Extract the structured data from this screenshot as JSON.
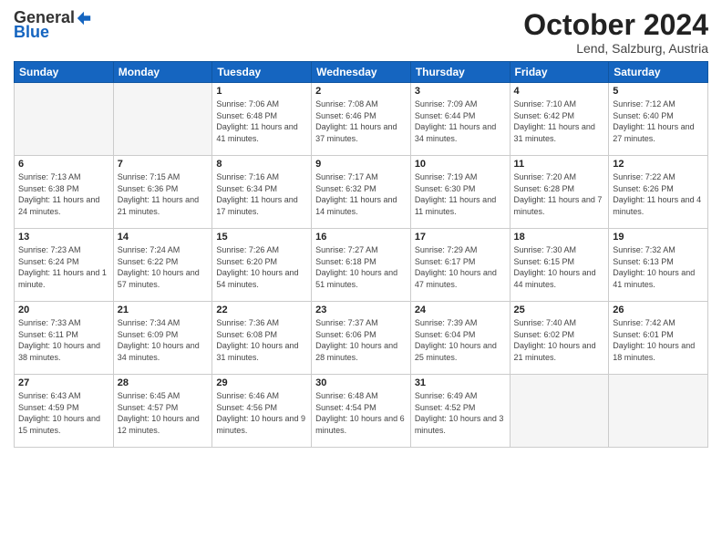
{
  "logo": {
    "general": "General",
    "blue": "Blue"
  },
  "header": {
    "month": "October 2024",
    "location": "Lend, Salzburg, Austria"
  },
  "weekdays": [
    "Sunday",
    "Monday",
    "Tuesday",
    "Wednesday",
    "Thursday",
    "Friday",
    "Saturday"
  ],
  "weeks": [
    [
      {
        "day": "",
        "info": ""
      },
      {
        "day": "",
        "info": ""
      },
      {
        "day": "1",
        "info": "Sunrise: 7:06 AM\nSunset: 6:48 PM\nDaylight: 11 hours and 41 minutes."
      },
      {
        "day": "2",
        "info": "Sunrise: 7:08 AM\nSunset: 6:46 PM\nDaylight: 11 hours and 37 minutes."
      },
      {
        "day": "3",
        "info": "Sunrise: 7:09 AM\nSunset: 6:44 PM\nDaylight: 11 hours and 34 minutes."
      },
      {
        "day": "4",
        "info": "Sunrise: 7:10 AM\nSunset: 6:42 PM\nDaylight: 11 hours and 31 minutes."
      },
      {
        "day": "5",
        "info": "Sunrise: 7:12 AM\nSunset: 6:40 PM\nDaylight: 11 hours and 27 minutes."
      }
    ],
    [
      {
        "day": "6",
        "info": "Sunrise: 7:13 AM\nSunset: 6:38 PM\nDaylight: 11 hours and 24 minutes."
      },
      {
        "day": "7",
        "info": "Sunrise: 7:15 AM\nSunset: 6:36 PM\nDaylight: 11 hours and 21 minutes."
      },
      {
        "day": "8",
        "info": "Sunrise: 7:16 AM\nSunset: 6:34 PM\nDaylight: 11 hours and 17 minutes."
      },
      {
        "day": "9",
        "info": "Sunrise: 7:17 AM\nSunset: 6:32 PM\nDaylight: 11 hours and 14 minutes."
      },
      {
        "day": "10",
        "info": "Sunrise: 7:19 AM\nSunset: 6:30 PM\nDaylight: 11 hours and 11 minutes."
      },
      {
        "day": "11",
        "info": "Sunrise: 7:20 AM\nSunset: 6:28 PM\nDaylight: 11 hours and 7 minutes."
      },
      {
        "day": "12",
        "info": "Sunrise: 7:22 AM\nSunset: 6:26 PM\nDaylight: 11 hours and 4 minutes."
      }
    ],
    [
      {
        "day": "13",
        "info": "Sunrise: 7:23 AM\nSunset: 6:24 PM\nDaylight: 11 hours and 1 minute."
      },
      {
        "day": "14",
        "info": "Sunrise: 7:24 AM\nSunset: 6:22 PM\nDaylight: 10 hours and 57 minutes."
      },
      {
        "day": "15",
        "info": "Sunrise: 7:26 AM\nSunset: 6:20 PM\nDaylight: 10 hours and 54 minutes."
      },
      {
        "day": "16",
        "info": "Sunrise: 7:27 AM\nSunset: 6:18 PM\nDaylight: 10 hours and 51 minutes."
      },
      {
        "day": "17",
        "info": "Sunrise: 7:29 AM\nSunset: 6:17 PM\nDaylight: 10 hours and 47 minutes."
      },
      {
        "day": "18",
        "info": "Sunrise: 7:30 AM\nSunset: 6:15 PM\nDaylight: 10 hours and 44 minutes."
      },
      {
        "day": "19",
        "info": "Sunrise: 7:32 AM\nSunset: 6:13 PM\nDaylight: 10 hours and 41 minutes."
      }
    ],
    [
      {
        "day": "20",
        "info": "Sunrise: 7:33 AM\nSunset: 6:11 PM\nDaylight: 10 hours and 38 minutes."
      },
      {
        "day": "21",
        "info": "Sunrise: 7:34 AM\nSunset: 6:09 PM\nDaylight: 10 hours and 34 minutes."
      },
      {
        "day": "22",
        "info": "Sunrise: 7:36 AM\nSunset: 6:08 PM\nDaylight: 10 hours and 31 minutes."
      },
      {
        "day": "23",
        "info": "Sunrise: 7:37 AM\nSunset: 6:06 PM\nDaylight: 10 hours and 28 minutes."
      },
      {
        "day": "24",
        "info": "Sunrise: 7:39 AM\nSunset: 6:04 PM\nDaylight: 10 hours and 25 minutes."
      },
      {
        "day": "25",
        "info": "Sunrise: 7:40 AM\nSunset: 6:02 PM\nDaylight: 10 hours and 21 minutes."
      },
      {
        "day": "26",
        "info": "Sunrise: 7:42 AM\nSunset: 6:01 PM\nDaylight: 10 hours and 18 minutes."
      }
    ],
    [
      {
        "day": "27",
        "info": "Sunrise: 6:43 AM\nSunset: 4:59 PM\nDaylight: 10 hours and 15 minutes."
      },
      {
        "day": "28",
        "info": "Sunrise: 6:45 AM\nSunset: 4:57 PM\nDaylight: 10 hours and 12 minutes."
      },
      {
        "day": "29",
        "info": "Sunrise: 6:46 AM\nSunset: 4:56 PM\nDaylight: 10 hours and 9 minutes."
      },
      {
        "day": "30",
        "info": "Sunrise: 6:48 AM\nSunset: 4:54 PM\nDaylight: 10 hours and 6 minutes."
      },
      {
        "day": "31",
        "info": "Sunrise: 6:49 AM\nSunset: 4:52 PM\nDaylight: 10 hours and 3 minutes."
      },
      {
        "day": "",
        "info": ""
      },
      {
        "day": "",
        "info": ""
      }
    ]
  ]
}
